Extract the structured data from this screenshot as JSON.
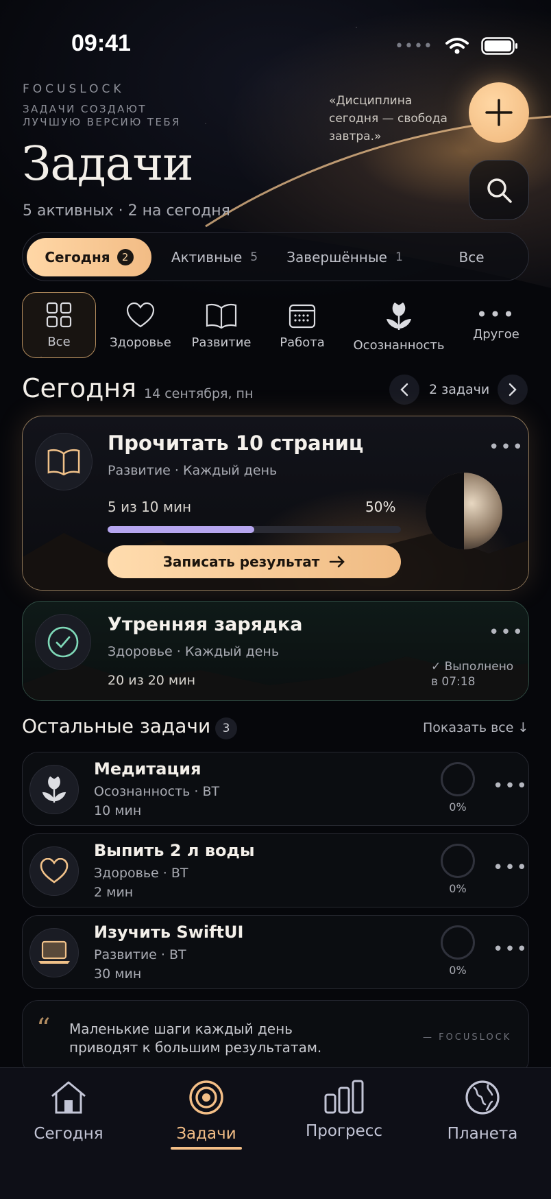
{
  "status": {
    "time": "09:41"
  },
  "header": {
    "brand": "FOCUSLOCK",
    "slogan": "ЗАДАЧИ СОЗДАЮТ ЛУЧШУЮ ВЕРСИЮ ТЕБЯ",
    "quote": "«Дисциплина сегодня — свобода завтра.»",
    "title": "Задачи",
    "subtitle": "5 активных · 2 на сегодня"
  },
  "filters": [
    {
      "label": "Сегодня",
      "count": "2"
    },
    {
      "label": "Активные",
      "count": "5"
    },
    {
      "label": "Завершённые",
      "count": "1"
    },
    {
      "label": "Все",
      "count": ""
    }
  ],
  "categories": [
    {
      "label": "Все",
      "icon": "grid-icon"
    },
    {
      "label": "Здоровье",
      "icon": "heart-icon"
    },
    {
      "label": "Развитие",
      "icon": "book-icon"
    },
    {
      "label": "Работа",
      "icon": "calendar-icon"
    },
    {
      "label": "Осознанность",
      "icon": "tulip-icon"
    },
    {
      "label": "Другое",
      "icon": "more-icon"
    }
  ],
  "today": {
    "title": "Сегодня",
    "date": "14 сентября, пн",
    "count": "2 задачи"
  },
  "featured": {
    "title": "Прочитать 10 страниц",
    "meta": "Развитие · Каждый день",
    "progress_text": "5 из 10 мин",
    "progress_pct": "50%",
    "progress": 0.5,
    "button": "Записать результат"
  },
  "done": {
    "title": "Утренняя зарядка",
    "meta": "Здоровье · Каждый день",
    "progress_text": "20 из 20 мин",
    "status": "✓ Выполнено",
    "time": "в 07:18"
  },
  "others": {
    "title": "Остальные задачи",
    "count": "3",
    "show_all": "Показать все ↓",
    "items": [
      {
        "title": "Медитация",
        "meta": "Осознанность · ВТ",
        "duration": "10 мин",
        "pct": "0%",
        "icon": "tulip-icon"
      },
      {
        "title": "Выпить 2 л воды",
        "meta": "Здоровье · ВТ",
        "duration": "2 мин",
        "pct": "0%",
        "icon": "heart-icon"
      },
      {
        "title": "Изучить SwiftUI",
        "meta": "Развитие · ВТ",
        "duration": "30 мин",
        "pct": "0%",
        "icon": "laptop-icon"
      }
    ]
  },
  "footer_quote": {
    "text": "Маленькие шаги каждый день приводят к большим результатам.",
    "author": "— FOCUSLOCK"
  },
  "tabs": [
    {
      "label": "Сегодня",
      "icon": "home-icon"
    },
    {
      "label": "Задачи",
      "icon": "target-icon"
    },
    {
      "label": "Прогресс",
      "icon": "bars-icon"
    },
    {
      "label": "Планета",
      "icon": "globe-icon"
    }
  ],
  "colors": {
    "accent": "#f3be86",
    "progress": "#b6a6f0",
    "done": "#7fd9b8"
  }
}
